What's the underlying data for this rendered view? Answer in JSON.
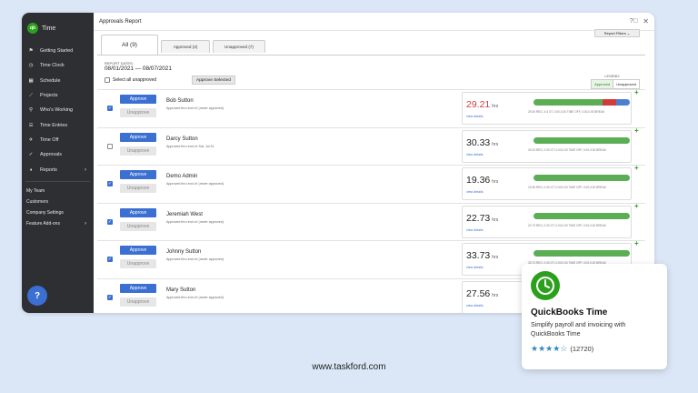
{
  "app": {
    "name": "Time",
    "logo_text": "qb",
    "window_title": "Approvals Report"
  },
  "sidebar": {
    "items": [
      {
        "label": "Getting Started",
        "icon": "flag-icon"
      },
      {
        "label": "Time Clock",
        "icon": "clock-icon"
      },
      {
        "label": "Schedule",
        "icon": "calendar-icon"
      },
      {
        "label": "Projects",
        "icon": "chart-line-icon"
      },
      {
        "label": "Who's Working",
        "icon": "location-pin-icon"
      },
      {
        "label": "Time Entries",
        "icon": "list-icon"
      },
      {
        "label": "Time Off",
        "icon": "airplane-icon"
      },
      {
        "label": "Approvals",
        "icon": "check-icon"
      },
      {
        "label": "Reports",
        "icon": "pie-chart-icon"
      }
    ],
    "sub_items": [
      {
        "label": "My Team"
      },
      {
        "label": "Customers"
      },
      {
        "label": "Company Settings"
      },
      {
        "label": "Feature Add-ons"
      }
    ],
    "help_label": "?"
  },
  "tabs": [
    {
      "label": "All (9)"
    },
    {
      "label": "Approved (2)"
    },
    {
      "label": "Unapproved (7)"
    }
  ],
  "report_filters_label": "Report Filters",
  "report_dates": {
    "label": "REPORT DATES:",
    "value": "08/01/2021 — 08/07/2021"
  },
  "select_all_label": "Select all unapproved",
  "approve_selected_label": "Approve Selected",
  "legend": {
    "label": "LEGEND:",
    "approved": "Approved",
    "unapproved": "Unapproved"
  },
  "row_labels": {
    "approve": "Approve",
    "unapprove": "Unapprove",
    "hrs": "hrs",
    "view_details": "view details"
  },
  "employees": [
    {
      "name": "Bob Sutton",
      "status": "Approved thru end of: (never approved)",
      "hours": "29.21",
      "warn": true,
      "checked": true,
      "desc": "29.30 REG, 4.5 OT, 0.00,0.00 TIME OFF, 0.00,0.00 BREAK",
      "segments": [
        {
          "frac": 0.72,
          "color": "#5cae55"
        },
        {
          "frac": 0.14,
          "color": "#d13b3b"
        },
        {
          "frac": 0.14,
          "color": "#4a7fd1"
        }
      ]
    },
    {
      "name": "Darcy Sutton",
      "status": "Approved thru end of: Sat, Jul 31",
      "hours": "30.33",
      "warn": false,
      "checked": false,
      "desc": "30.33 REG, 0.00 OT, 0.00,0.00 TIME OFF, 0.00,0.00 BREAK",
      "segments": [
        {
          "frac": 1.0,
          "color": "#5cae55"
        }
      ]
    },
    {
      "name": "Demo Admin",
      "status": "Approved thru end of: (never approved)",
      "hours": "19.36",
      "warn": false,
      "checked": true,
      "desc": "19.36 REG, 0.00 OT, 0.00,0.00 TIME OFF, 0.00,0.00 BREAK",
      "segments": [
        {
          "frac": 1.0,
          "color": "#5cae55"
        }
      ]
    },
    {
      "name": "Jeremiah West",
      "status": "Approved thru end of: (never approved)",
      "hours": "22.73",
      "warn": false,
      "checked": true,
      "desc": "22.73 REG, 0.00 OT, 0.00,0.00 TIME OFF, 0.00,0.00 BREAK",
      "segments": [
        {
          "frac": 1.0,
          "color": "#5cae55"
        }
      ]
    },
    {
      "name": "Johnny Sutton",
      "status": "Approved thru end of: (never approved)",
      "hours": "33.73",
      "warn": false,
      "checked": true,
      "desc": "33.73 REG, 0.00 OT, 0.00,0.00 TIME OFF, 0.00,0.00 BREAK",
      "segments": [
        {
          "frac": 1.0,
          "color": "#5cae55"
        }
      ]
    },
    {
      "name": "Mary Sutton",
      "status": "Approved thru end of: (never approved)",
      "hours": "27.56",
      "warn": false,
      "checked": true,
      "desc": "27.56 REG, 0.00 OT, 0.00,0.00 TIME OFF, 0.00,0.00 BREAK",
      "segments": [
        {
          "frac": 1.0,
          "color": "#5cae55"
        }
      ]
    }
  ],
  "card": {
    "title": "QuickBooks Time",
    "description": "Simplify payroll and invoicing with QuickBooks Time",
    "rating_stars": 4,
    "rating_count": "(12720)"
  },
  "footer": {
    "link": "www.taskford.com"
  },
  "colors": {
    "accent": "#3b6fd1",
    "brand": "#2ca01c",
    "warn": "#d13b3b"
  }
}
